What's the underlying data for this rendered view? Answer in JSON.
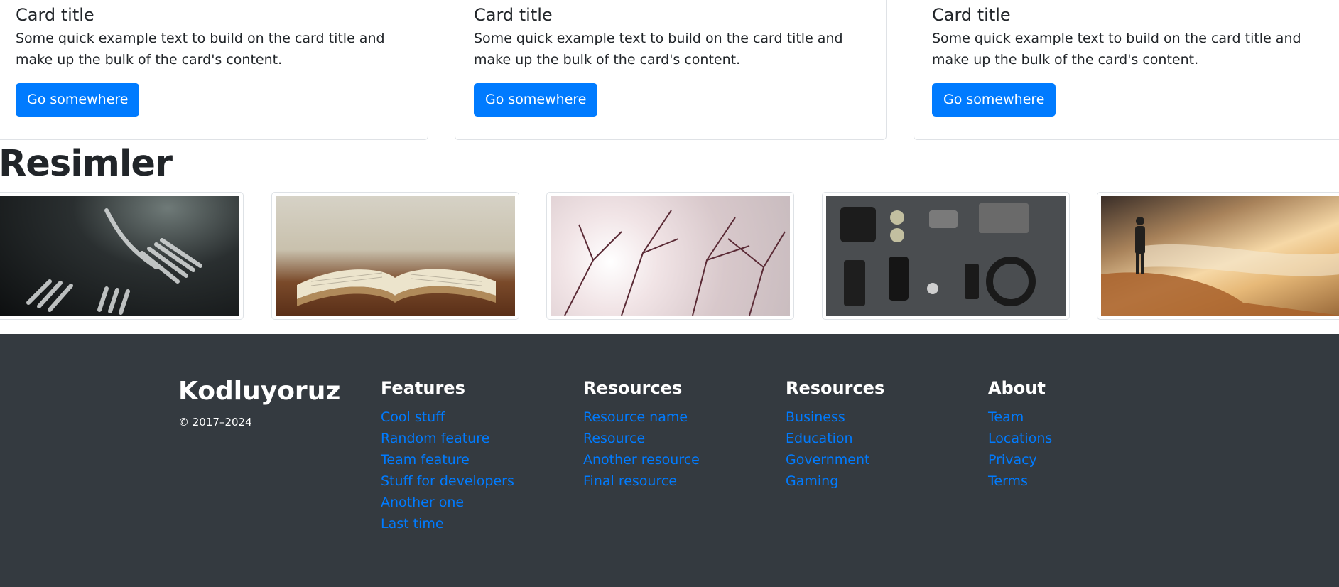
{
  "cards": [
    {
      "title": "Card title",
      "text": "Some quick example text to build on the card title and make up the bulk of the card's content.",
      "button": "Go somewhere"
    },
    {
      "title": "Card title",
      "text": "Some quick example text to build on the card title and make up the bulk of the card's content.",
      "button": "Go somewhere"
    },
    {
      "title": "Card title",
      "text": "Some quick example text to build on the card title and make up the bulk of the card's content.",
      "button": "Go somewhere"
    }
  ],
  "gallery": {
    "title": "Resimler",
    "images": [
      {
        "name": "forks-image"
      },
      {
        "name": "open-book-image"
      },
      {
        "name": "tree-branches-image"
      },
      {
        "name": "accessories-flatlay-image"
      },
      {
        "name": "person-by-sea-image"
      }
    ]
  },
  "footer": {
    "brand": "Kodluyoruz",
    "copyright": "© 2017–2024",
    "columns": [
      {
        "title": "Features",
        "links": [
          "Cool stuff",
          "Random feature",
          "Team feature",
          "Stuff for developers",
          "Another one",
          "Last time"
        ]
      },
      {
        "title": "Resources",
        "links": [
          "Resource name",
          "Resource",
          "Another resource",
          "Final resource"
        ]
      },
      {
        "title": "Resources",
        "links": [
          "Business",
          "Education",
          "Government",
          "Gaming"
        ]
      },
      {
        "title": "About",
        "links": [
          "Team",
          "Locations",
          "Privacy",
          "Terms"
        ]
      }
    ]
  },
  "colors": {
    "primary": "#007bff",
    "footer_bg": "#343a40"
  }
}
